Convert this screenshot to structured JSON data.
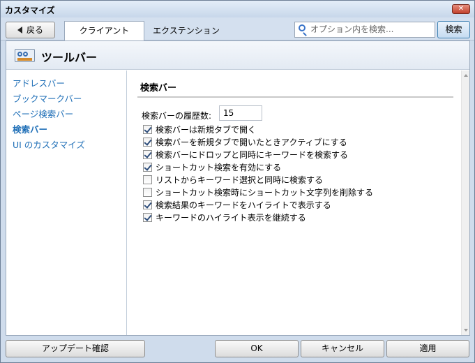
{
  "window": {
    "title": "カスタマイズ",
    "close_glyph": "✕"
  },
  "toolbar": {
    "back_label": "戻る",
    "tabs": [
      {
        "label": "クライアント",
        "active": true
      },
      {
        "label": "エクステンション",
        "active": false
      }
    ],
    "search_placeholder": "オプション内を検索...",
    "search_button": "検索"
  },
  "header": {
    "title": "ツールバー",
    "icon": "toolbar-icon"
  },
  "sidebar": {
    "items": [
      {
        "label": "アドレスバー",
        "active": false
      },
      {
        "label": "ブックマークバー",
        "active": false
      },
      {
        "label": "ページ検索バー",
        "active": false
      },
      {
        "label": "検索バー",
        "active": true
      },
      {
        "label": "UI のカスタマイズ",
        "active": false
      }
    ]
  },
  "content": {
    "section_title": "検索バー",
    "history_label": "検索バーの履歴数:",
    "history_value": "15",
    "options": [
      {
        "label": "検索バーは新規タブで開く",
        "checked": true
      },
      {
        "label": "検索バーを新規タブで開いたときアクティブにする",
        "checked": true
      },
      {
        "label": "検索バーにドロップと同時にキーワードを検索する",
        "checked": true
      },
      {
        "label": "ショートカット検索を有効にする",
        "checked": true
      },
      {
        "label": "リストからキーワード選択と同時に検索する",
        "checked": false
      },
      {
        "label": "ショートカット検索時にショートカット文字列を削除する",
        "checked": false
      },
      {
        "label": "検索結果のキーワードをハイライトで表示する",
        "checked": true
      },
      {
        "label": "キーワードのハイライト表示を継続する",
        "checked": true
      }
    ]
  },
  "footer": {
    "update_button": "アップデート確認",
    "ok_button": "OK",
    "cancel_button": "キャンセル",
    "apply_button": "適用"
  }
}
